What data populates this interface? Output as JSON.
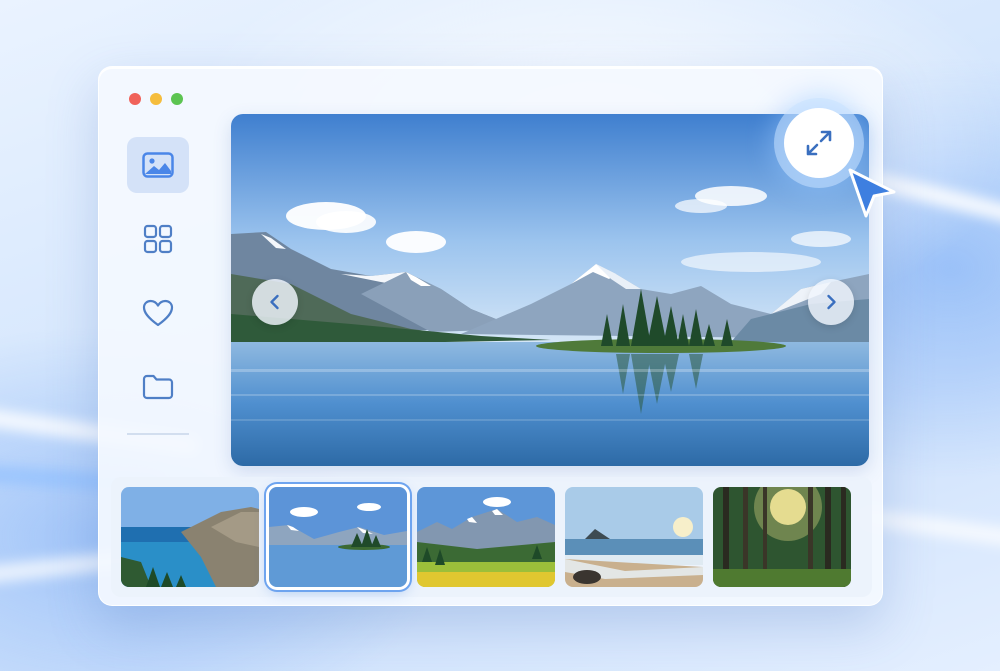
{
  "window": {
    "controls": [
      "close",
      "minimize",
      "maximize"
    ]
  },
  "sidebar": {
    "items": [
      {
        "icon": "image-icon",
        "active": true
      },
      {
        "icon": "grid-icon",
        "active": false
      },
      {
        "icon": "heart-icon",
        "active": false
      },
      {
        "icon": "folder-icon",
        "active": false
      }
    ]
  },
  "viewer": {
    "current_image": "mountain-lake",
    "prev_icon": "chevron-left-icon",
    "next_icon": "chevron-right-icon",
    "expand_icon": "expand-icon"
  },
  "thumbnails": [
    {
      "scene": "coastal-cliffs",
      "selected": false
    },
    {
      "scene": "mountain-lake",
      "selected": true
    },
    {
      "scene": "alpine-meadow",
      "selected": false
    },
    {
      "scene": "beach-sunset",
      "selected": false
    },
    {
      "scene": "sunlit-forest",
      "selected": false
    }
  ],
  "colors": {
    "accent": "#4a86e8",
    "icon": "#4f7fc6",
    "selected_border": "#6ea4ef"
  }
}
